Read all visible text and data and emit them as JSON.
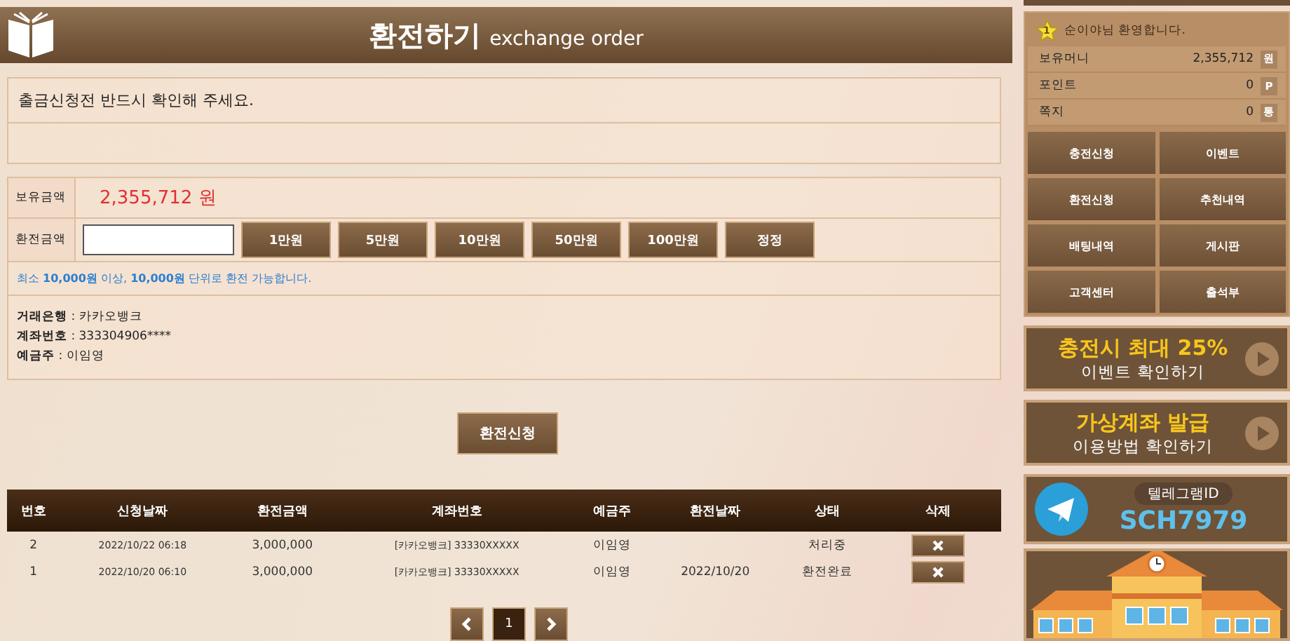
{
  "header": {
    "title": "환전하기",
    "subtitle": "exchange order"
  },
  "notice": {
    "text": "출금신청전 반드시 확인해 주세요."
  },
  "form": {
    "balance_label": "보유금액",
    "balance": "2,355,712 원",
    "amount_label": "환전금액",
    "quick_buttons": [
      "1만원",
      "5만원",
      "10만원",
      "50만원",
      "100만원",
      "정정"
    ],
    "hint": "최소 **10,000원** 이상, **10,000원**  단위로 환전 가능합니다.",
    "bank_info": [
      "**거래은행** : 카카오뱅크",
      "**계좌번호** : 333304906****",
      "**예금주** : 이임영"
    ]
  },
  "submit_button": "환전신청",
  "table": {
    "columns": [
      "번호",
      "신청날짜",
      "환전금액",
      "계좌번호",
      "예금주",
      "환전날짜",
      "상태",
      "삭제"
    ],
    "rows": [
      {
        "cells": [
          "2",
          "2022/10/22 06:18",
          "3,000,000",
          "[카카오뱅크] 33330XXXXX",
          "이임영",
          "",
          "처리중"
        ]
      },
      {
        "cells": [
          "1",
          "2022/10/20 06:10",
          "3,000,000",
          "[카카오뱅크] 33330XXXXX",
          "이임영",
          "2022/10/20",
          "환전완료"
        ]
      }
    ]
  },
  "pagination": [
    {
      "label": "1",
      "selected": true
    }
  ],
  "sidebar": {
    "welcome": {
      "badge": "1",
      "text": "순이야님 환영합니다."
    },
    "stats": [
      {
        "label": "보유머니",
        "value": "2,355,712",
        "unit": "원"
      },
      {
        "label": "포인트",
        "value": "0",
        "unit": "P"
      },
      {
        "label": "쪽지",
        "value": "0",
        "unit": "통"
      }
    ],
    "menu": [
      "충전신청",
      "이벤트",
      "환전신청",
      "추천내역",
      "배팅내역",
      "게시판",
      "고객센터",
      "출석부"
    ],
    "banners": [
      {
        "title": "충전시 최대 25%",
        "subtitle": "이벤트 확인하기"
      },
      {
        "title": "가상계좌 발급",
        "subtitle": "이용방법 확인하기"
      }
    ],
    "telegram": {
      "label": "텔레그램ID",
      "id": "SCH7979"
    }
  }
}
